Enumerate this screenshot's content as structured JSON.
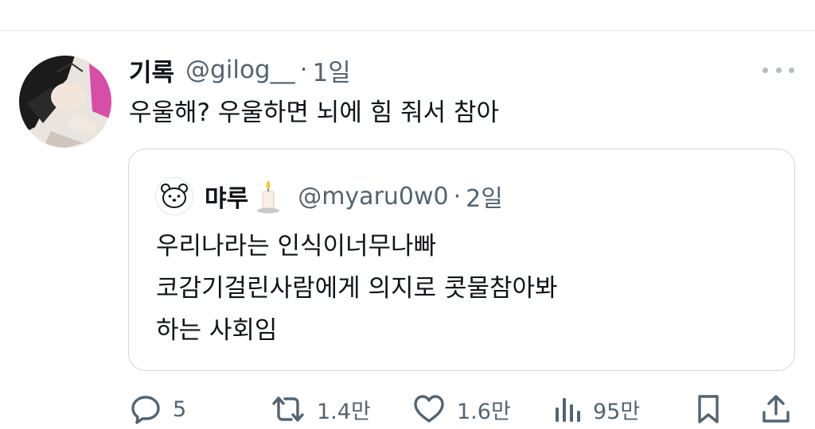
{
  "tweet": {
    "author_name": "기록",
    "handle": "@gilog__",
    "separator": "·",
    "time": "1일",
    "text": "우울해? 우울하면 뇌에 힘 줘서 참아"
  },
  "quoted_tweet": {
    "author_name": "먀루",
    "handle": "@myaru0w0",
    "separator": "·",
    "time": "2일",
    "lines": [
      "우리나라는 인식이너무나빠",
      "코감기걸린사람에게 의지로 콧물참아봐",
      "하는 사회임"
    ]
  },
  "actions": {
    "reply": {
      "icon": "reply-icon",
      "count": "5"
    },
    "retweet": {
      "icon": "retweet-icon",
      "count": "1.4만"
    },
    "like": {
      "icon": "heart-icon",
      "count": "1.6만"
    },
    "views": {
      "icon": "views-icon",
      "count": "95만"
    },
    "bookmark": {
      "icon": "bookmark-icon"
    },
    "share": {
      "icon": "share-icon"
    }
  },
  "colors": {
    "text": "#0f1419",
    "muted": "#536471",
    "border": "#cfd9de",
    "icon": "#536471"
  }
}
